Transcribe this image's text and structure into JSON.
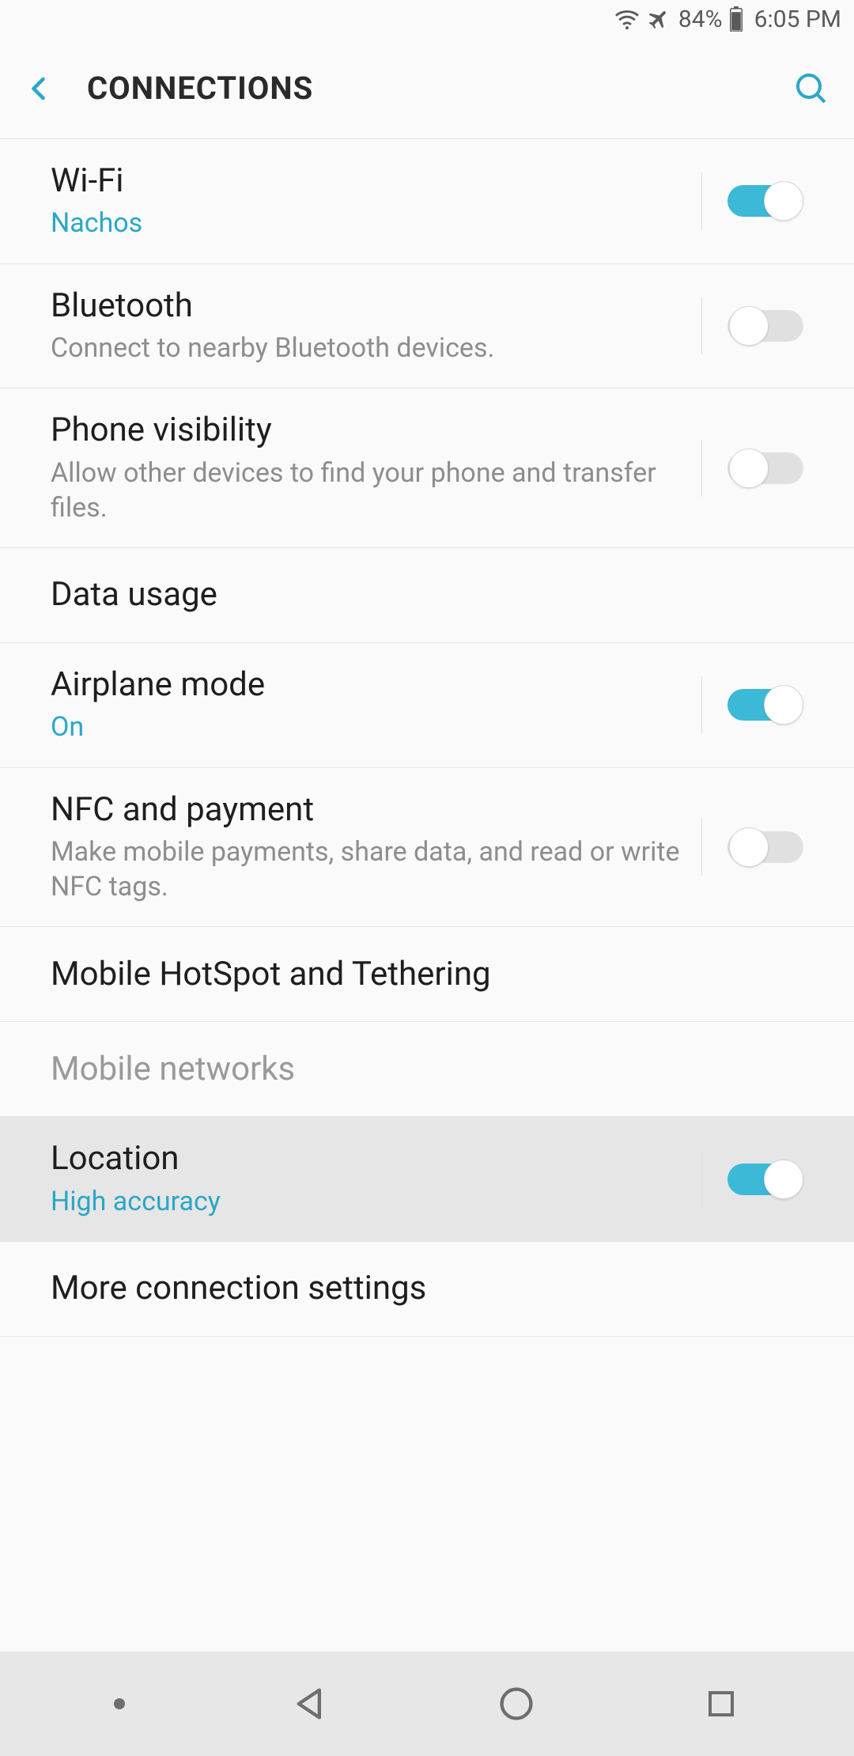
{
  "status": {
    "battery_pct": "84%",
    "time": "6:05 PM"
  },
  "header": {
    "title": "CONNECTIONS"
  },
  "rows": {
    "wifi": {
      "title": "Wi-Fi",
      "sub": "Nachos",
      "on": true
    },
    "bt": {
      "title": "Bluetooth",
      "sub": "Connect to nearby Bluetooth devices.",
      "on": false
    },
    "vis": {
      "title": "Phone visibility",
      "sub": "Allow other devices to find your phone and transfer files.",
      "on": false
    },
    "data": {
      "title": "Data usage"
    },
    "air": {
      "title": "Airplane mode",
      "sub": "On",
      "on": true
    },
    "nfc": {
      "title": "NFC and payment",
      "sub": "Make mobile payments, share data, and read or write NFC tags.",
      "on": false
    },
    "hotspot": {
      "title": "Mobile HotSpot and Tethering"
    },
    "mobnet": {
      "title": "Mobile networks"
    },
    "loc": {
      "title": "Location",
      "sub": "High accuracy",
      "on": true
    },
    "more": {
      "title": "More connection settings"
    }
  }
}
